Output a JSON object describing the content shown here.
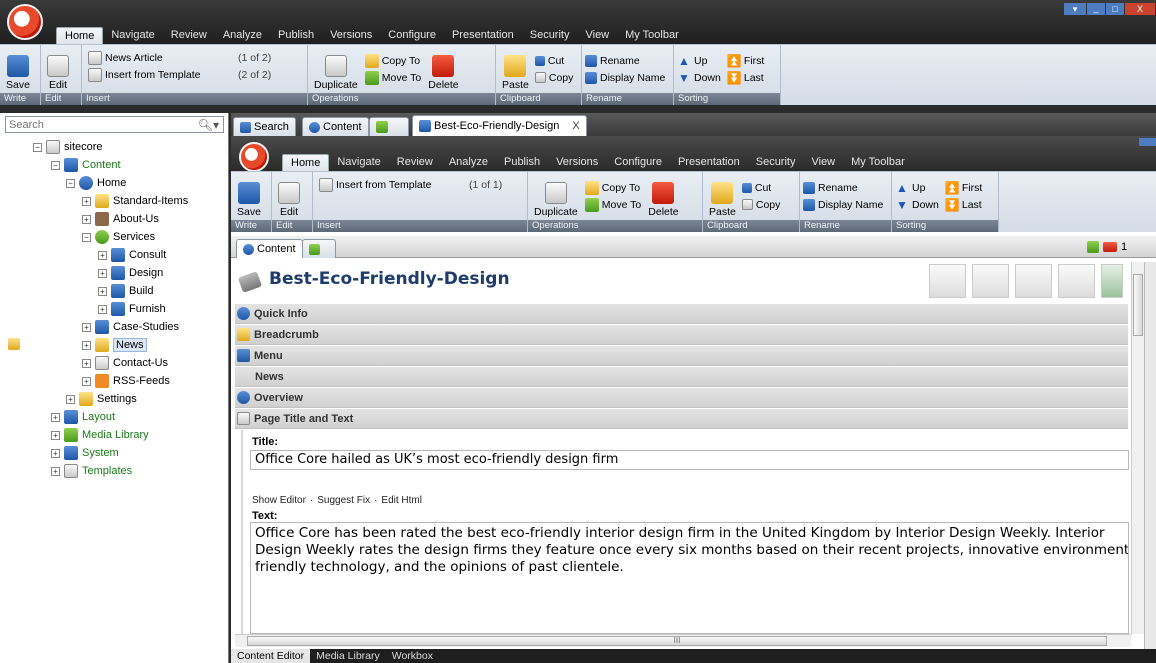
{
  "window_buttons": {
    "min": "▾",
    "restore": "_",
    "max": "□",
    "close": "X"
  },
  "outer_ribbon": {
    "tabs": [
      "Home",
      "Navigate",
      "Review",
      "Analyze",
      "Publish",
      "Versions",
      "Configure",
      "Presentation",
      "Security",
      "View",
      "My Toolbar"
    ],
    "write": {
      "save": "Save",
      "title": "Write"
    },
    "edit": {
      "label": "Edit",
      "title": "Edit"
    },
    "insert": {
      "items": [
        {
          "label": "News Article",
          "count": "(1 of 2)"
        },
        {
          "label": "Insert from Template",
          "count": "(2 of 2)"
        }
      ],
      "title": "Insert"
    },
    "operations": {
      "duplicate": "Duplicate",
      "copy_to": "Copy To",
      "move_to": "Move To",
      "delete": "Delete",
      "title": "Operations"
    },
    "clipboard": {
      "paste": "Paste",
      "cut": "Cut",
      "copy": "Copy",
      "title": "Clipboard"
    },
    "rename": {
      "rename": "Rename",
      "display_name": "Display Name",
      "title": "Rename"
    },
    "sorting": {
      "up": "Up",
      "down": "Down",
      "first": "First",
      "last": "Last",
      "title": "Sorting"
    }
  },
  "search": {
    "placeholder": "Search"
  },
  "tree": {
    "sitecore": "sitecore",
    "content": "Content",
    "home": "Home",
    "standard": "Standard-Items",
    "about": "About-Us",
    "services": "Services",
    "consult": "Consult",
    "design": "Design",
    "build": "Build",
    "furnish": "Furnish",
    "case": "Case-Studies",
    "news": "News",
    "contact": "Contact-Us",
    "rss": "RSS-Feeds",
    "settings": "Settings",
    "layout": "Layout",
    "media": "Media Library",
    "system": "System",
    "templates": "Templates"
  },
  "doc_tabs": {
    "search": "Search",
    "content": "Content",
    "item": "Best-Eco-Friendly-Design",
    "close": "X"
  },
  "inner_ribbon": {
    "tabs": [
      "Home",
      "Navigate",
      "Review",
      "Analyze",
      "Publish",
      "Versions",
      "Configure",
      "Presentation",
      "Security",
      "View",
      "My Toolbar"
    ],
    "save": "Save",
    "edit": "Edit",
    "write_title": "Write",
    "edit_title": "Edit",
    "insert_label": "Insert from Template",
    "insert_count": "(1 of 1)",
    "insert_title": "Insert",
    "duplicate": "Duplicate",
    "copy_to": "Copy To",
    "move_to": "Move To",
    "delete": "Delete",
    "operations_title": "Operations",
    "paste": "Paste",
    "cut": "Cut",
    "copy": "Copy",
    "clipboard_title": "Clipboard",
    "rename": "Rename",
    "display_name": "Display Name",
    "rename_title": "Rename",
    "up": "Up",
    "down": "Down",
    "first": "First",
    "last": "Last",
    "sorting_title": "Sorting"
  },
  "editor": {
    "tab": "Content",
    "lang": "1",
    "item_title": "Best-Eco-Friendly-Design",
    "sections": {
      "quick": "Quick Info",
      "breadcrumb": "Breadcrumb",
      "menu": "Menu",
      "news": "News",
      "overview": "Overview",
      "page": "Page Title and Text"
    },
    "title_label": "Title:",
    "title_value": "Office Core hailed as UK’s most eco-friendly design firm",
    "rte_links": {
      "show": "Show Editor",
      "suggest": "Suggest Fix",
      "html": "Edit Html",
      "sep": "·"
    },
    "text_label": "Text:",
    "text_lines": [
      "Office Core has been rated the best eco-friendly interior design firm in the United Kingdom by Interior Design Weekly. Interior",
      "Design Weekly rates the design firms they feature once every six months based on their recent projects, innovative environmentall",
      "friendly technology, and the opinions of past clientele."
    ],
    "hscroll_grip": "III"
  },
  "bottom_tabs": [
    "Content Editor",
    "Media Library",
    "Workbox"
  ]
}
